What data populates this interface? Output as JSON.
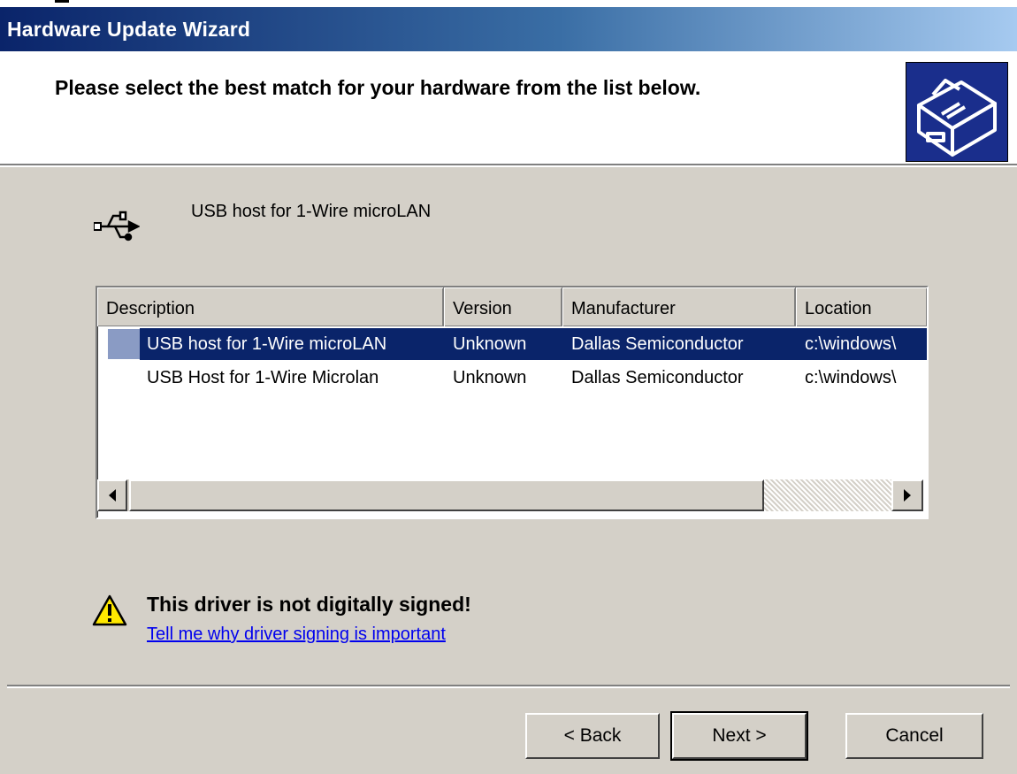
{
  "window": {
    "title": "Hardware Update Wizard"
  },
  "header": {
    "text": "Please select the best match for your hardware from the list below."
  },
  "device": {
    "name": "USB host for 1-Wire microLAN"
  },
  "list": {
    "columns": [
      "Description",
      "Version",
      "Manufacturer",
      "Location"
    ],
    "rows": [
      {
        "description": "USB host for 1-Wire microLAN",
        "version": "Unknown",
        "manufacturer": "Dallas Semiconductor",
        "location": "c:\\windows\\",
        "selected": true
      },
      {
        "description": "USB Host for 1-Wire Microlan",
        "version": "Unknown",
        "manufacturer": "Dallas Semiconductor",
        "location": "c:\\windows\\",
        "selected": false
      }
    ]
  },
  "warning": {
    "text": "This driver is not digitally signed!",
    "link": "Tell me why driver signing is important"
  },
  "buttons": {
    "back": "< Back",
    "next": "Next >",
    "cancel": "Cancel"
  },
  "colors": {
    "titlebar_start": "#0a246a",
    "titlebar_end": "#a6caf0",
    "selection": "#0a246a",
    "face": "#d4d0c8"
  },
  "icons": [
    "hardware-wizard-icon",
    "usb-icon",
    "warning-icon",
    "scroll-left-arrow-icon",
    "scroll-right-arrow-icon"
  ]
}
